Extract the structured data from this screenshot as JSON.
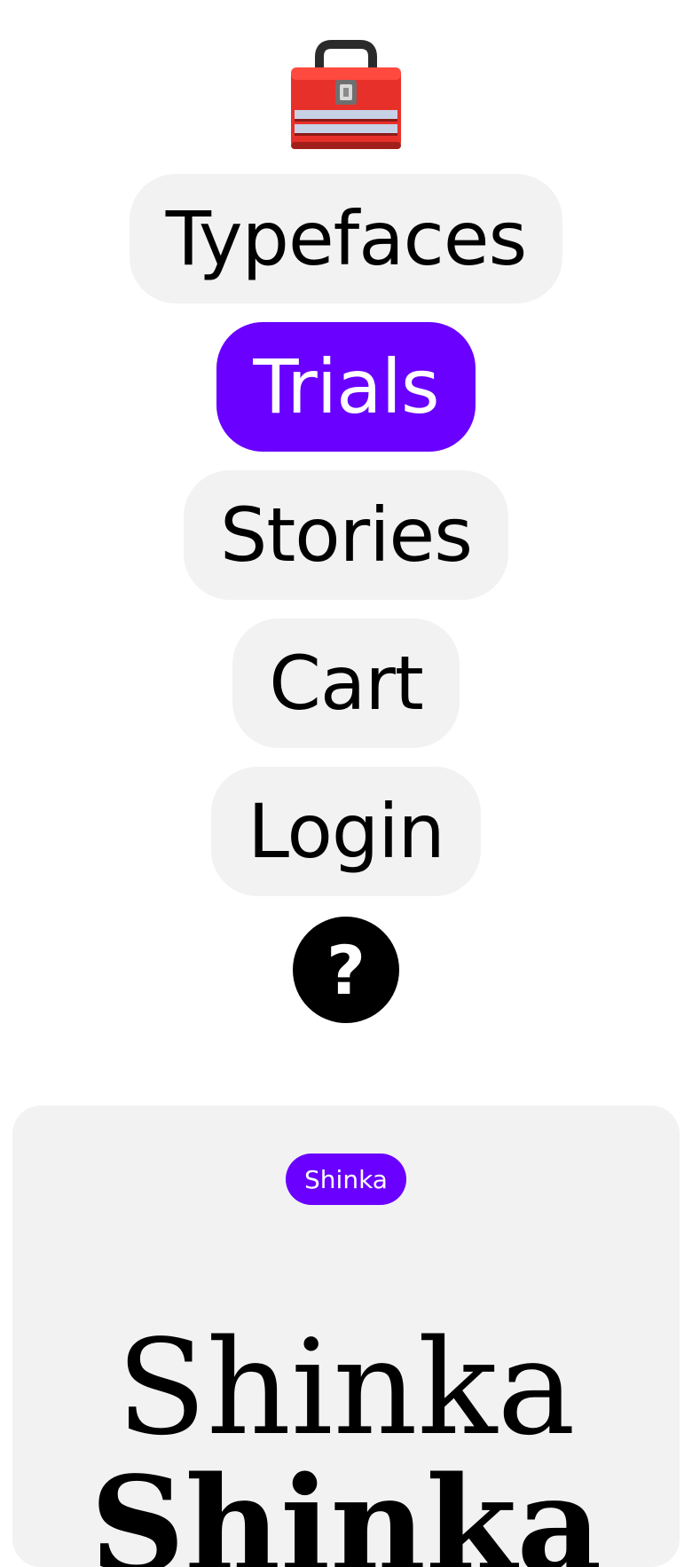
{
  "header": {
    "logo_icon": "toolbox-icon"
  },
  "nav": {
    "items": [
      {
        "label": "Typefaces"
      },
      {
        "label": "Trials"
      },
      {
        "label": "Stories"
      },
      {
        "label": "Cart"
      },
      {
        "label": "Login"
      }
    ],
    "active": "Trials",
    "help_label": "?"
  },
  "card": {
    "tag_label": "Shinka",
    "specimen_line_1": "Shinka",
    "specimen_line_2": "Shinka"
  },
  "colors": {
    "accent": "#6a00ff",
    "pill_background": "#f2f2f2",
    "card_background": "#f2f2f2"
  }
}
